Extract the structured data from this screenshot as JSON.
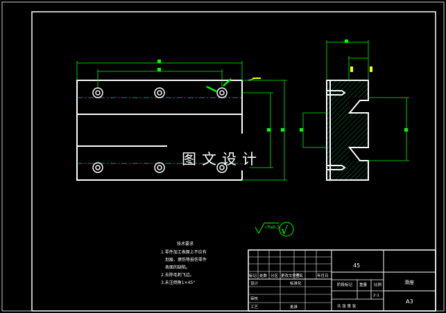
{
  "colors": {
    "background": "#000000",
    "outline": "#ffffff",
    "dimension": "#00ff00",
    "centerline": "#00cccc",
    "hatch": "#00aa66",
    "annotation": "#ffff00"
  },
  "watermark": "图文设计",
  "roughness": {
    "symbol": "√Ra6.3",
    "check": "√"
  },
  "tech_requirements": {
    "title": "技术要求",
    "lines": [
      "1.零件加工表面上不应有",
      "划痕、擦伤等损伤零件",
      "表面的缺陷。",
      "2.去除毛刺飞边。",
      "3.未注倒角1×45°"
    ]
  },
  "title_block": {
    "material": "45",
    "part_name": "滑座",
    "sheet_size": "A3",
    "scale": "2:1",
    "header_cells": [
      "标记",
      "处数",
      "分区",
      "更改文件号",
      "签名",
      "年月日"
    ],
    "designer_row": [
      "设计",
      "标准化"
    ],
    "approve_row": [
      "审核"
    ],
    "process_row": [
      "工艺",
      "批准"
    ],
    "stage_labels": [
      "阶段标记",
      "重量",
      "比例"
    ],
    "sheet_label": "共 张 第 张"
  }
}
